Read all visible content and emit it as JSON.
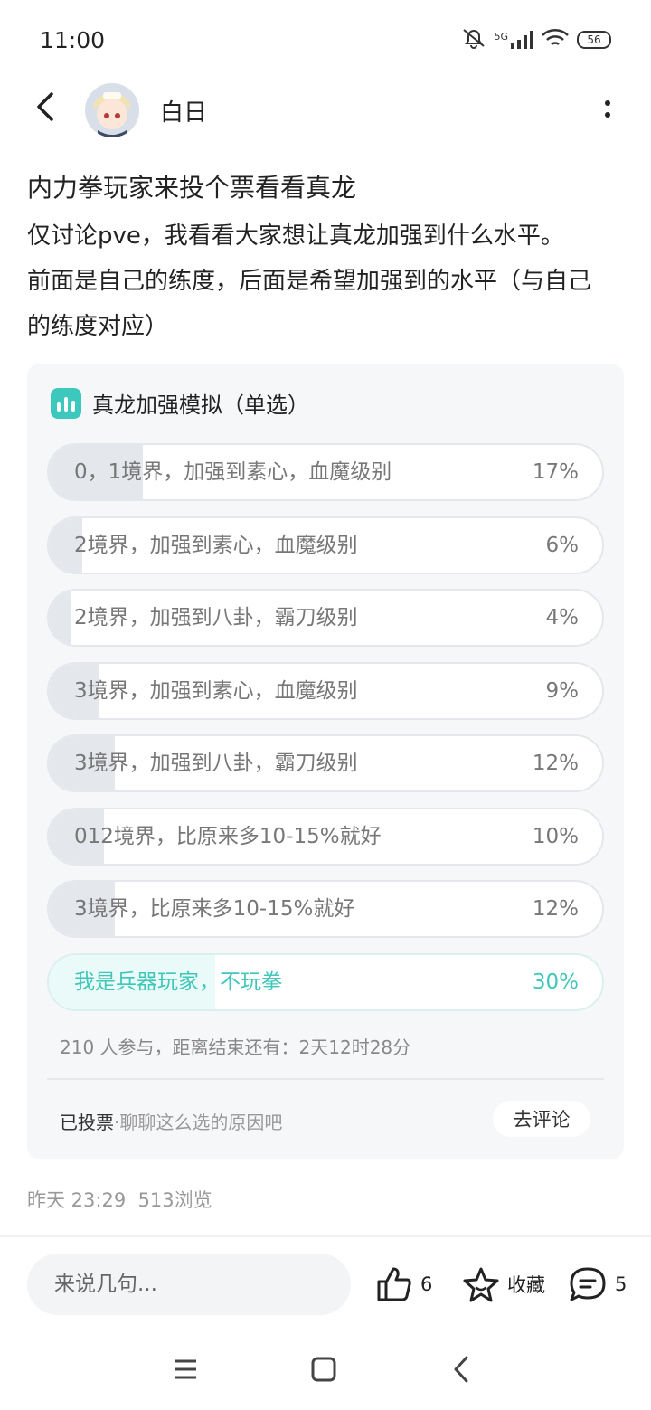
{
  "status_bar": {
    "time": "11:00",
    "network": "5G",
    "battery": "56"
  },
  "header": {
    "username": "白日"
  },
  "post": {
    "title": "内力拳玩家来投个票看看真龙",
    "body_lines": [
      "仅讨论pve，我看看大家想让真龙加强到什么水平。",
      "前面是自己的练度，后面是希望加强到的水平（与自己",
      "的练度对应）"
    ]
  },
  "poll": {
    "title": "真龙加强模拟（单选）",
    "options": [
      {
        "label": "0，1境界，加强到素心，血魔级别",
        "percent": "17%",
        "fraction": 0.17,
        "selected": false
      },
      {
        "label": "2境界，加强到素心，血魔级别",
        "percent": "6%",
        "fraction": 0.06,
        "selected": false
      },
      {
        "label": "2境界，加强到八卦，霸刀级别",
        "percent": "4%",
        "fraction": 0.04,
        "selected": false
      },
      {
        "label": "3境界，加强到素心，血魔级别",
        "percent": "9%",
        "fraction": 0.09,
        "selected": false
      },
      {
        "label": "3境界，加强到八卦，霸刀级别",
        "percent": "12%",
        "fraction": 0.12,
        "selected": false
      },
      {
        "label": "012境界，比原来多10-15%就好",
        "percent": "10%",
        "fraction": 0.1,
        "selected": false
      },
      {
        "label": "3境界，比原来多10-15%就好",
        "percent": "12%",
        "fraction": 0.12,
        "selected": false
      },
      {
        "label": "我是兵器玩家，不玩拳",
        "percent": "30%",
        "fraction": 0.3,
        "selected": true
      }
    ],
    "meta": "210 人参与，距离结束还有：2天12时28分",
    "voted_label": "已投票",
    "voted_hint": "·聊聊这么选的原因吧",
    "comment_button": "去评论"
  },
  "post_meta": {
    "time": "昨天 23:29",
    "views": "513浏览"
  },
  "bottom_bar": {
    "input_placeholder": "来说几句...",
    "like_count": "6",
    "favorite_label": "收藏",
    "comment_count": "5"
  },
  "colors": {
    "accent": "#3fc7b9",
    "poll_bg": "#f6f7f9",
    "fill": "#e4e7ec",
    "selected_fill": "#e9faf8"
  },
  "icons": [
    "back-arrow-icon",
    "more-vertical-icon",
    "poll-chart-icon",
    "thumbs-up-icon",
    "star-icon",
    "comment-bubble-icon",
    "nav-menu-icon",
    "nav-home-icon",
    "nav-back-icon"
  ]
}
